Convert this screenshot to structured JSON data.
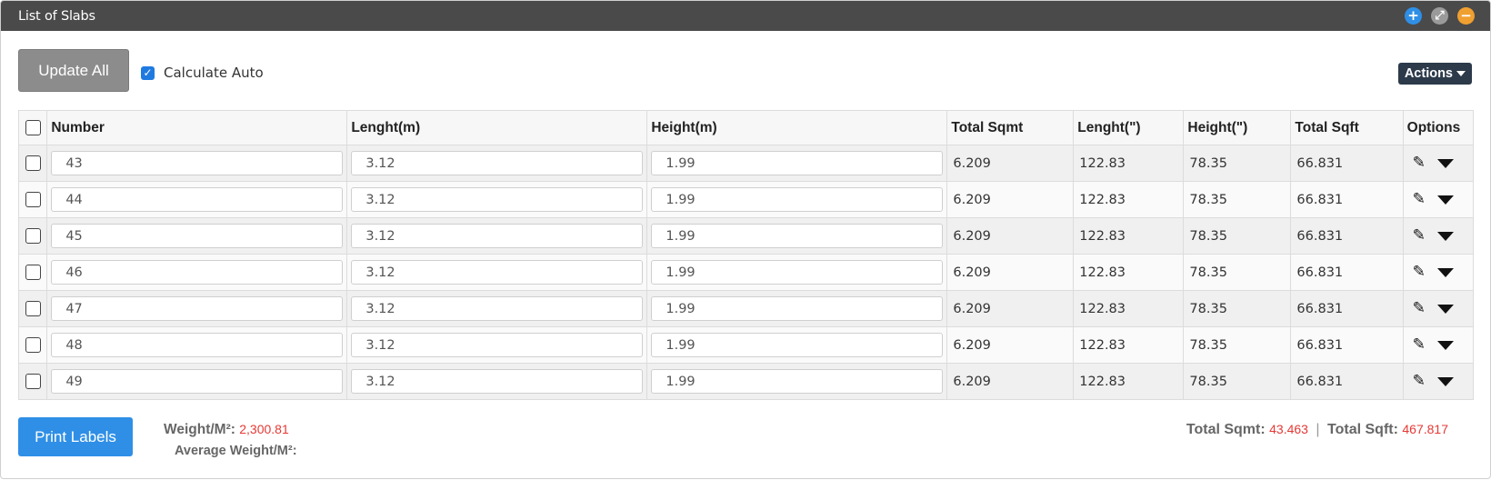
{
  "window": {
    "title": "List of Slabs",
    "icons": [
      "plus-circle-icon",
      "expand-icon",
      "minus-circle-icon"
    ],
    "icon_glyphs": [
      "+",
      "⤢",
      "−"
    ]
  },
  "toolbar": {
    "update_all_label": "Update All",
    "calculate_auto_label": "Calculate Auto",
    "calculate_auto_checked": true,
    "actions_label": "Actions"
  },
  "table": {
    "columns": [
      "Number",
      "Lenght(m)",
      "Height(m)",
      "Total Sqmt",
      "Lenght(\")",
      "Height(\")",
      "Total Sqft",
      "Options"
    ],
    "rows": [
      {
        "number": "43",
        "length_m": "3.12",
        "height_m": "1.99",
        "total_sqmt": "6.209",
        "length_in": "122.83",
        "height_in": "78.35",
        "total_sqft": "66.831"
      },
      {
        "number": "44",
        "length_m": "3.12",
        "height_m": "1.99",
        "total_sqmt": "6.209",
        "length_in": "122.83",
        "height_in": "78.35",
        "total_sqft": "66.831"
      },
      {
        "number": "45",
        "length_m": "3.12",
        "height_m": "1.99",
        "total_sqmt": "6.209",
        "length_in": "122.83",
        "height_in": "78.35",
        "total_sqft": "66.831"
      },
      {
        "number": "46",
        "length_m": "3.12",
        "height_m": "1.99",
        "total_sqmt": "6.209",
        "length_in": "122.83",
        "height_in": "78.35",
        "total_sqft": "66.831"
      },
      {
        "number": "47",
        "length_m": "3.12",
        "height_m": "1.99",
        "total_sqmt": "6.209",
        "length_in": "122.83",
        "height_in": "78.35",
        "total_sqft": "66.831"
      },
      {
        "number": "48",
        "length_m": "3.12",
        "height_m": "1.99",
        "total_sqmt": "6.209",
        "length_in": "122.83",
        "height_in": "78.35",
        "total_sqft": "66.831"
      },
      {
        "number": "49",
        "length_m": "3.12",
        "height_m": "1.99",
        "total_sqmt": "6.209",
        "length_in": "122.83",
        "height_in": "78.35",
        "total_sqft": "66.831"
      }
    ]
  },
  "footer": {
    "print_labels_label": "Print Labels",
    "weight_label": "Weight/M²:",
    "weight_value": "2,300.81",
    "average_weight_label": "Average Weight/M²:",
    "total_sqmt_label": "Total Sqmt:",
    "total_sqmt_value": "43.463",
    "separator": "|",
    "total_sqft_label": "Total Sqft:",
    "total_sqft_value": "467.817"
  },
  "colors": {
    "title_bar": "#4a4a4a",
    "primary_button": "#2f8fe6",
    "secondary_button": "#8c8c8c",
    "actions_button": "#2c3a4a",
    "highlight_value": "#e53935"
  }
}
